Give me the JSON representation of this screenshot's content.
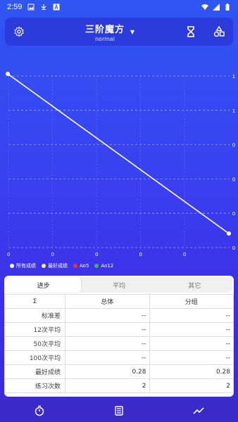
{
  "status_bar": {
    "time": "2:59"
  },
  "toolbar": {
    "title": "三阶魔方",
    "subtitle": "normal"
  },
  "chart_data": {
    "type": "line",
    "x": [
      1,
      2
    ],
    "series": [
      {
        "name": "所有成绩",
        "values": [
          1,
          0
        ],
        "color": "#ffffff"
      }
    ],
    "ylim": [
      0,
      1
    ],
    "y_ticks": [
      "1",
      "1",
      "0",
      "0",
      "0",
      "0"
    ],
    "x_ticks": [
      "0",
      "0",
      "0",
      "0",
      "0"
    ],
    "grid": true
  },
  "legend": [
    {
      "label": "所有成绩",
      "color": "#ffffff"
    },
    {
      "label": "最好成绩",
      "color": "#f5f0a0"
    },
    {
      "label": "Ao5",
      "color": "#e53935"
    },
    {
      "label": "Ao12",
      "color": "#4caf50"
    }
  ],
  "tabs": [
    "进步",
    "平均",
    "其它"
  ],
  "table": {
    "sigma": "Σ",
    "headers": [
      "总体",
      "分组"
    ],
    "rows": [
      {
        "label": "标准差",
        "total": "--",
        "group": "--"
      },
      {
        "label": "12次平均",
        "total": "--",
        "group": "--"
      },
      {
        "label": "50次平均",
        "total": "--",
        "group": "--"
      },
      {
        "label": "100次平均",
        "total": "--",
        "group": "--"
      },
      {
        "label": "最好成绩",
        "total": "0.28",
        "group": "0.28"
      },
      {
        "label": "练习次数",
        "total": "2",
        "group": "2"
      }
    ]
  },
  "icons": {
    "settings": "gear-icon",
    "timer_mode": "hourglass-icon",
    "puzzle_type": "shapes-icon",
    "nav_timer": "stopwatch-icon",
    "nav_list": "list-icon",
    "nav_stats": "trend-icon"
  }
}
